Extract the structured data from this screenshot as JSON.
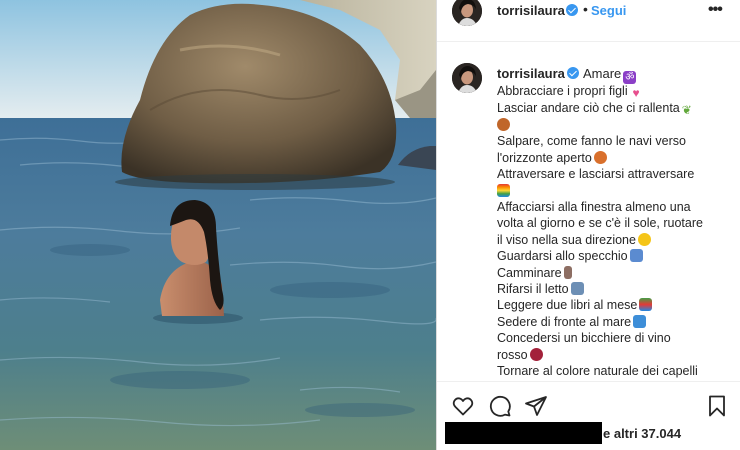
{
  "post": {
    "username": "torrisilaura",
    "follow_label": "Segui",
    "separator": "•",
    "more_glyph": "•••"
  },
  "caption": {
    "username": "torrisilaura",
    "title": "Amare",
    "lines": [
      "Abbracciare i propri figli",
      "Lasciar andare ciò che ci rallenta",
      "",
      "Salpare, come fanno le navi verso",
      "l'orizzonte aperto",
      "Attraversare e lasciarsi attraversare",
      "",
      "Affacciarsi alla finestra almeno una",
      "volta al giorno e se c'è il sole, ruotare",
      "il viso nella sua direzione",
      "Guardarsi allo specchio",
      "Camminare",
      "Rifarsi il letto",
      "Leggere due libri al mese",
      "Sedere di fronte al mare",
      "Concedersi un bicchiere di vino",
      "rosso",
      "Tornare al colore naturale dei capelli"
    ]
  },
  "likes": {
    "text": "e altri 37.044"
  },
  "icons": {
    "like": "heart-icon",
    "comment": "comment-icon",
    "share": "paper-plane-icon",
    "save": "bookmark-icon",
    "verified": "verified-badge-icon",
    "more": "more-options-icon"
  },
  "colors": {
    "link_blue": "#3897f0",
    "verified_blue": "#3897f0",
    "text": "#262626",
    "border": "#efefef"
  }
}
